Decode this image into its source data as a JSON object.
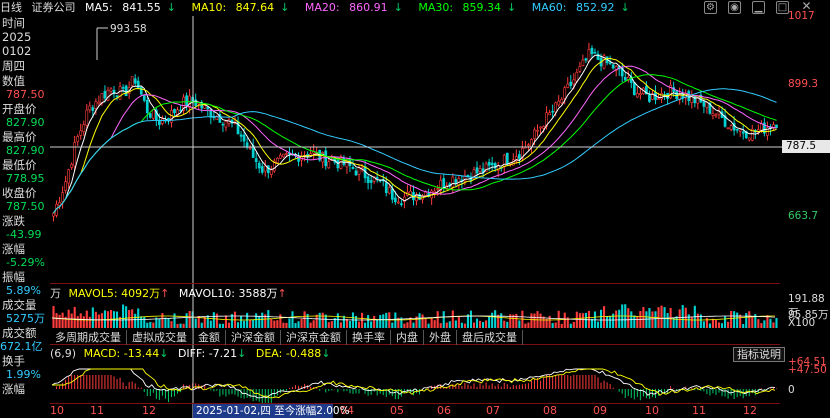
{
  "header": {
    "period": "日线",
    "name": "证券公司",
    "ma": [
      {
        "label": "MA5:",
        "value": "841.55",
        "arrow": "↓",
        "color": "#ffffff"
      },
      {
        "label": "MA10:",
        "value": "847.64",
        "arrow": "↓",
        "color": "#ffff00"
      },
      {
        "label": "MA20:",
        "value": "860.91",
        "arrow": "↓",
        "color": "#ff66ff"
      },
      {
        "label": "MA30:",
        "value": "859.34",
        "arrow": "↓",
        "color": "#00ff00"
      },
      {
        "label": "MA60:",
        "value": "852.92",
        "arrow": "↓",
        "color": "#33ccff"
      }
    ],
    "icons": [
      "settings-icon",
      "eye-icon",
      "minimize-icon",
      "maximize-icon",
      "close-icon"
    ]
  },
  "info_panel": {
    "time_label": "时间",
    "date_year": "2025",
    "date_md": "0102",
    "weekday": "周四",
    "value_label": "数值",
    "value": "787.50",
    "open_label": "开盘价",
    "open": "827.90",
    "high_label": "最高价",
    "high": "827.90",
    "low_label": "最低价",
    "low": "778.95",
    "close_label": "收盘价",
    "close": "787.50",
    "change_label": "涨跌",
    "change": "-43.99",
    "pct_label": "涨幅",
    "pct": "-5.29%",
    "amp_label": "振幅",
    "amp": "5.89%",
    "vol_label": "成交量",
    "vol": "5275万",
    "amt_label": "成交额",
    "amt": "672.1亿",
    "turnover_label": "换手",
    "turnover": "1.99%",
    "flow_label": "涨幅"
  },
  "price_axis": {
    "ticks": [
      "1017",
      "899.3",
      "787.5",
      "663.7"
    ],
    "current": "787.5"
  },
  "annotations": {
    "high_mark": "993.58"
  },
  "volume": {
    "prefix": "万",
    "mavol5_label": "MAVOL5:",
    "mavol5": "4092万",
    "mavol5_arrow": "↑",
    "mavol10_label": "MAVOL10:",
    "mavol10": "3588万",
    "mavol10_arrow": "↑",
    "axis": [
      "191.88万",
      "95.85万",
      "X100"
    ]
  },
  "tabs": [
    "多周期成交量",
    "虚拟成交量",
    "金额",
    "沪深金额",
    "沪深京金额",
    "换手率",
    "内盘",
    "外盘",
    "盘后成交量"
  ],
  "macd": {
    "params": "(6,9)",
    "macd_label": "MACD:",
    "macd": "-13.44",
    "macd_arrow": "↓",
    "diff_label": "DIFF:",
    "diff": "-7.21",
    "diff_arrow": "↓",
    "dea_label": "DEA:",
    "dea": "-0.488",
    "dea_arrow": "↓",
    "help": "指标说明",
    "axis": [
      "+64.51",
      "+47.50",
      "0"
    ]
  },
  "x_axis": {
    "labels": [
      "10",
      "11",
      "12",
      "04",
      "05",
      "06",
      "07",
      "08",
      "09",
      "10",
      "11",
      "12"
    ],
    "tooltip": "2025-01-02,四 至今涨幅2.00%"
  },
  "chart_data": {
    "type": "candlestick",
    "ylim": [
      600,
      1030
    ],
    "close_series": [
      710,
      760,
      830,
      880,
      900,
      915,
      905,
      930,
      880,
      860,
      870,
      890,
      895,
      880,
      870,
      860,
      840,
      805,
      780,
      790,
      800,
      805,
      810,
      800,
      795,
      790,
      780,
      770,
      760,
      740,
      735,
      740,
      745,
      755,
      765,
      770,
      775,
      780,
      790,
      800,
      810,
      830,
      860,
      880,
      910,
      940,
      970,
      960,
      950,
      930,
      910,
      900,
      905,
      910,
      905,
      895,
      885,
      870,
      855,
      845,
      842,
      850,
      860
    ],
    "marks": {
      "high": 993.58,
      "current": 787.5
    }
  }
}
